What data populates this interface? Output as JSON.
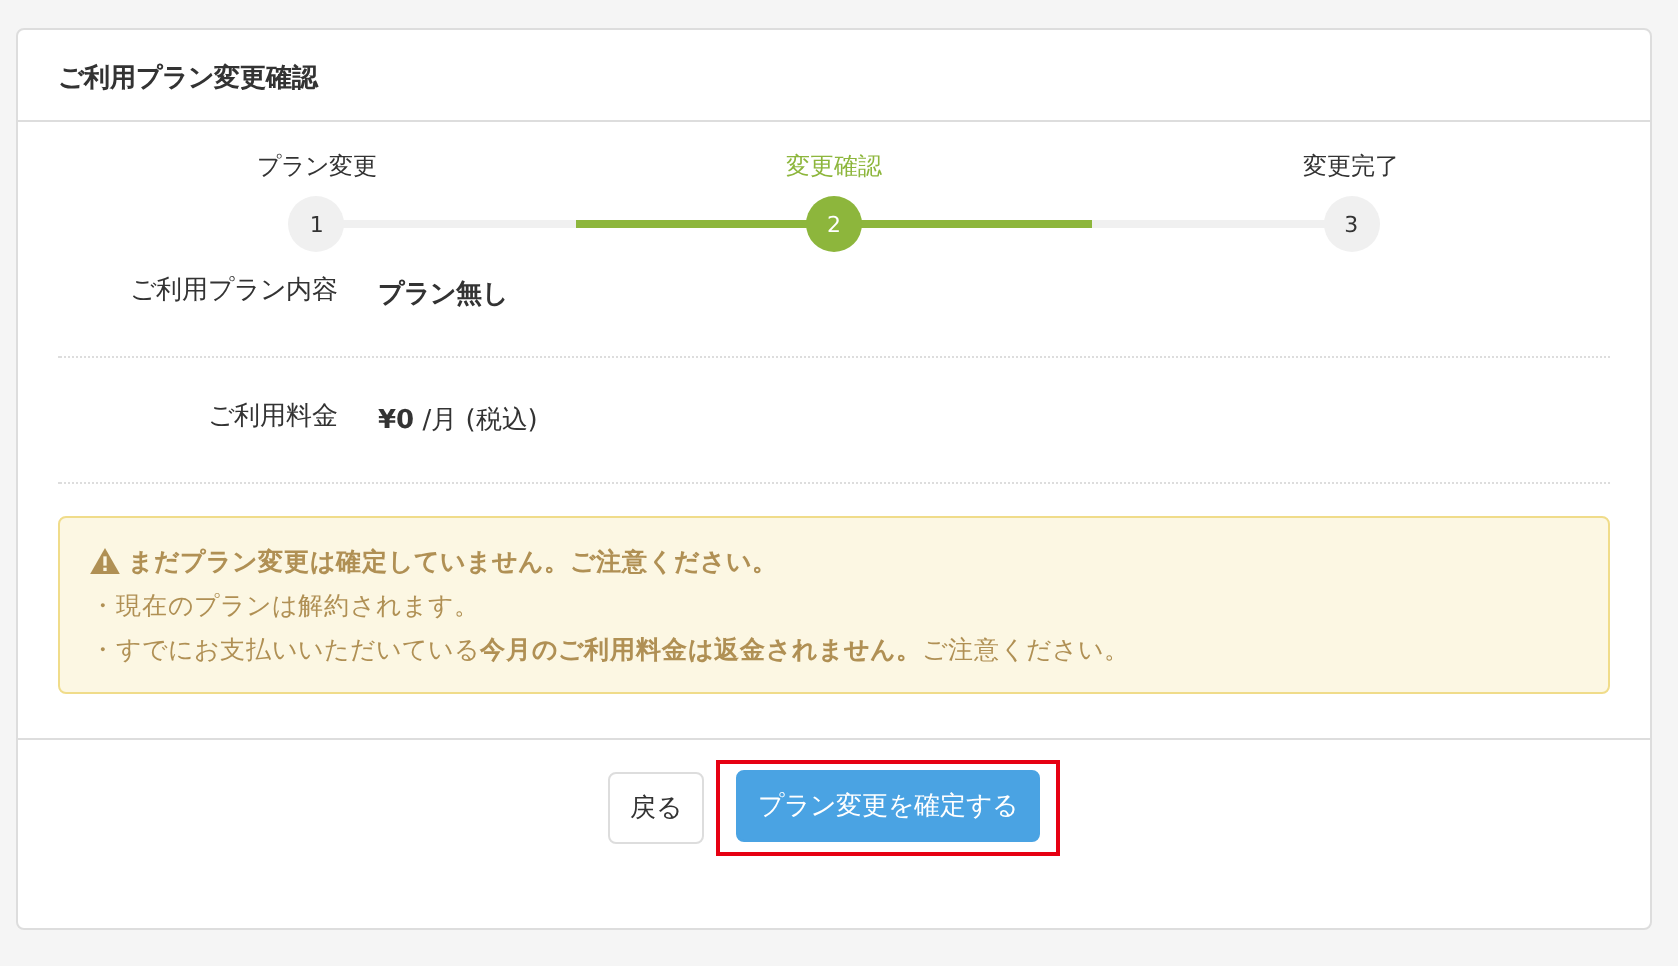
{
  "card": {
    "title": "ご利用プラン変更確認"
  },
  "steps": [
    {
      "label": "プラン変更",
      "number": "1",
      "selected": false
    },
    {
      "label": "変更確認",
      "number": "2",
      "selected": true
    },
    {
      "label": "変更完了",
      "number": "3",
      "selected": false
    }
  ],
  "details": [
    {
      "label": "ご利用プラン内容",
      "value": "プラン無し"
    },
    {
      "label": "ご利用料金",
      "value": "**¥0** /月 (税込)"
    }
  ],
  "alert": {
    "heading": "まだプラン変更は確定していません。ご注意ください。",
    "lines": [
      "・現在のプランは解約されます。",
      "・すでにお支払いいただいている**今月のご利用料金は返金されません。**ご注意ください。"
    ]
  },
  "buttons": [
    {
      "label": "戻る",
      "kind": "default",
      "highlighted": false
    },
    {
      "label": "プラン変更を確定する",
      "kind": "primary",
      "highlighted": true
    }
  ]
}
